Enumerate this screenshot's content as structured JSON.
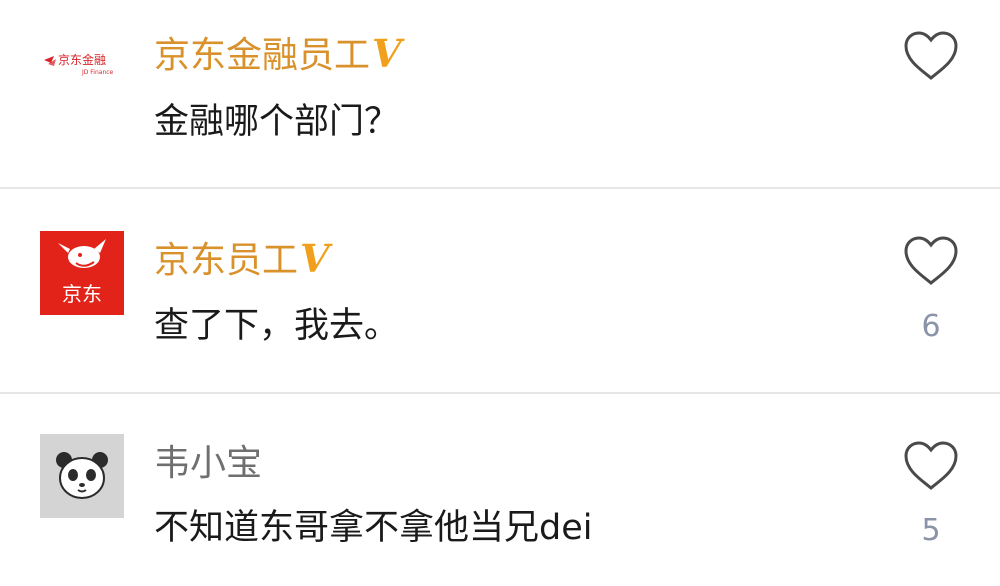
{
  "comments": [
    {
      "username": "京东金融员工",
      "verified_badge": "V",
      "text": "金融哪个部门？",
      "likes": "",
      "avatar": {
        "type": "jd-finance-logo",
        "logo_text": "京东金融",
        "logo_subtext": "JD Finance",
        "logo_color": "#d6262b"
      }
    },
    {
      "username": "京东员工",
      "verified_badge": "V",
      "text": "查了下，我去。",
      "likes": "6",
      "avatar": {
        "type": "jd-logo",
        "logo_text": "京东",
        "background_color": "#e2231a"
      }
    },
    {
      "username": "韦小宝",
      "verified_badge": "",
      "text": "不知道东哥拿不拿他当兄dei",
      "likes": "5",
      "avatar": {
        "type": "panda-default",
        "background_color": "#d4d4d4"
      }
    }
  ],
  "colors": {
    "verified_name": "#d9912b",
    "badge": "#f0a01c",
    "normal_name": "#6f6f6f",
    "like_count": "#8a93a8",
    "divider": "#e6e6e6"
  },
  "icons": {
    "like": "heart-outline-icon"
  }
}
